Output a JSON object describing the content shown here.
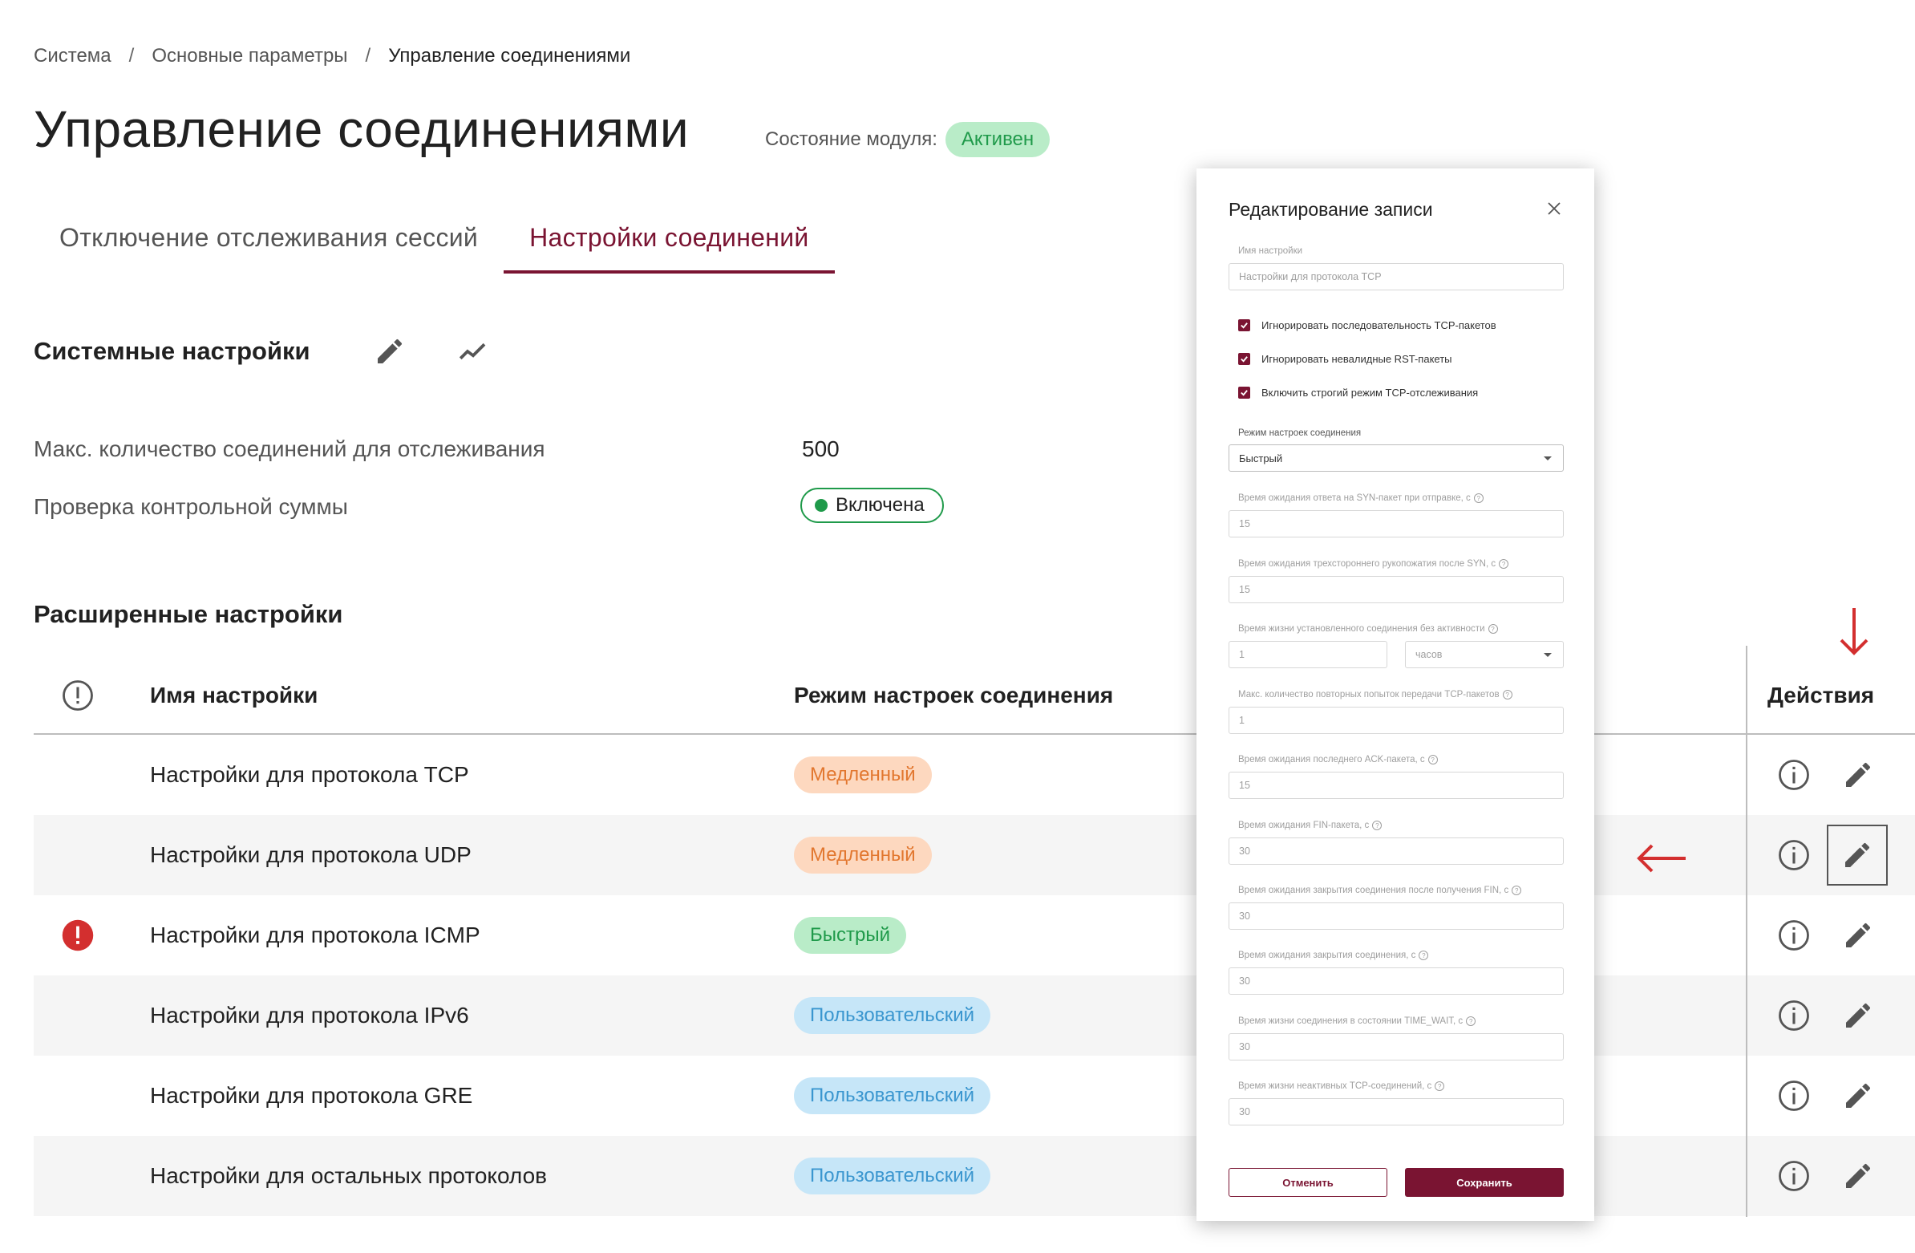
{
  "breadcrumb": [
    "Система",
    "Основные параметры",
    "Управление соединениями"
  ],
  "page_title": "Управление соединениями",
  "module_state": {
    "label": "Состояние модуля:",
    "value": "Активен"
  },
  "tabs": [
    {
      "label": "Отключение отслеживания сессий",
      "active": false
    },
    {
      "label": "Настройки соединений",
      "active": true
    }
  ],
  "system": {
    "title": "Системные настройки",
    "params": [
      {
        "label": "Макс. количество соединений для отслеживания",
        "value": "500"
      },
      {
        "label": "Проверка контрольной суммы",
        "value": "Включена"
      }
    ]
  },
  "advanced": {
    "title": "Расширенные настройки",
    "headers": {
      "name": "Имя настройки",
      "mode": "Режим настроек соединения",
      "actions": "Действия"
    },
    "rows": [
      {
        "name": "Настройки для протокола TCP",
        "mode": "Медленный",
        "warning": false
      },
      {
        "name": "Настройки для протокола UDP",
        "mode": "Медленный",
        "warning": false
      },
      {
        "name": "Настройки для протокола ICMP",
        "mode": "Быстрый",
        "warning": true
      },
      {
        "name": "Настройки для протокола IPv6",
        "mode": "Пользовательский",
        "warning": false
      },
      {
        "name": "Настройки для протокола GRE",
        "mode": "Пользовательский",
        "warning": false
      },
      {
        "name": "Настройки для остальных протоколов",
        "mode": "Пользовательский",
        "warning": false
      }
    ]
  },
  "modal": {
    "title": "Редактирование записи",
    "name_label": "Имя настройки",
    "name_placeholder": "Настройки для протокола TCP",
    "checkboxes": [
      "Игнорировать последовательность TCP-пакетов",
      "Игнорировать невалидные RST-пакеты",
      "Включить строгий режим TCP-отслеживания"
    ],
    "mode_label": "Режим настроек соединения",
    "mode_value": "Быстрый",
    "fields": [
      {
        "label": "Время ожидания ответа на SYN-пакет при отправке, с",
        "value": "15"
      },
      {
        "label": "Время ожидания трехстороннего рукопожатия после SYN, с",
        "value": "15"
      },
      {
        "label": "Время жизни установленного соединения без активности",
        "value": "1",
        "unit": "часов"
      },
      {
        "label": "Макс. количество повторных попыток передачи TCP-пакетов",
        "value": "1"
      },
      {
        "label": "Время ожидания последнего ACK-пакета, с",
        "value": "15"
      },
      {
        "label": "Время ожидания FIN-пакета, с",
        "value": "30"
      },
      {
        "label": "Время ожидания закрытия соединения после получения FIN, с",
        "value": "30"
      },
      {
        "label": "Время ожидания закрытия соединения, с",
        "value": "30"
      },
      {
        "label": "Время жизни соединения в состоянии TIME_WAIT, с",
        "value": "30"
      },
      {
        "label": "Время жизни неактивных TCP-соединений, с",
        "value": "30"
      }
    ],
    "cancel": "Отменить",
    "save": "Сохранить"
  },
  "colors": {
    "accent": "#7a1432",
    "success": "#1f9a4a",
    "warning": "#e2772f",
    "info": "#3a96cf",
    "error": "#d32f2f",
    "guide_arrow": "#d32f2f"
  }
}
